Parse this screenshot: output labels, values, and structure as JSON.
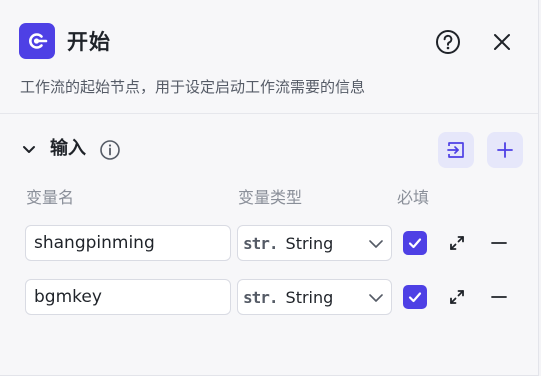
{
  "header": {
    "title": "开始",
    "description": "工作流的起始节点，用于设定启动工作流需要的信息",
    "logo_icon": "start-node-icon",
    "help_icon": "question-circle-icon",
    "close_icon": "close-icon"
  },
  "input_section": {
    "title": "输入",
    "info_icon": "info-circle-icon",
    "import_icon": "import-icon",
    "add_icon": "plus-icon",
    "columns": {
      "name": "变量名",
      "type": "变量类型",
      "required": "必填"
    },
    "variables": [
      {
        "name": "shangpinming",
        "type_tag": "str.",
        "type": "String",
        "required": true
      },
      {
        "name": "bgmkey",
        "type_tag": "str.",
        "type": "String",
        "required": true
      }
    ]
  },
  "colors": {
    "accent": "#4e40e5",
    "accent_light": "#e6e7fa",
    "background": "#f7f7f9",
    "muted_text": "#8a8f99"
  }
}
